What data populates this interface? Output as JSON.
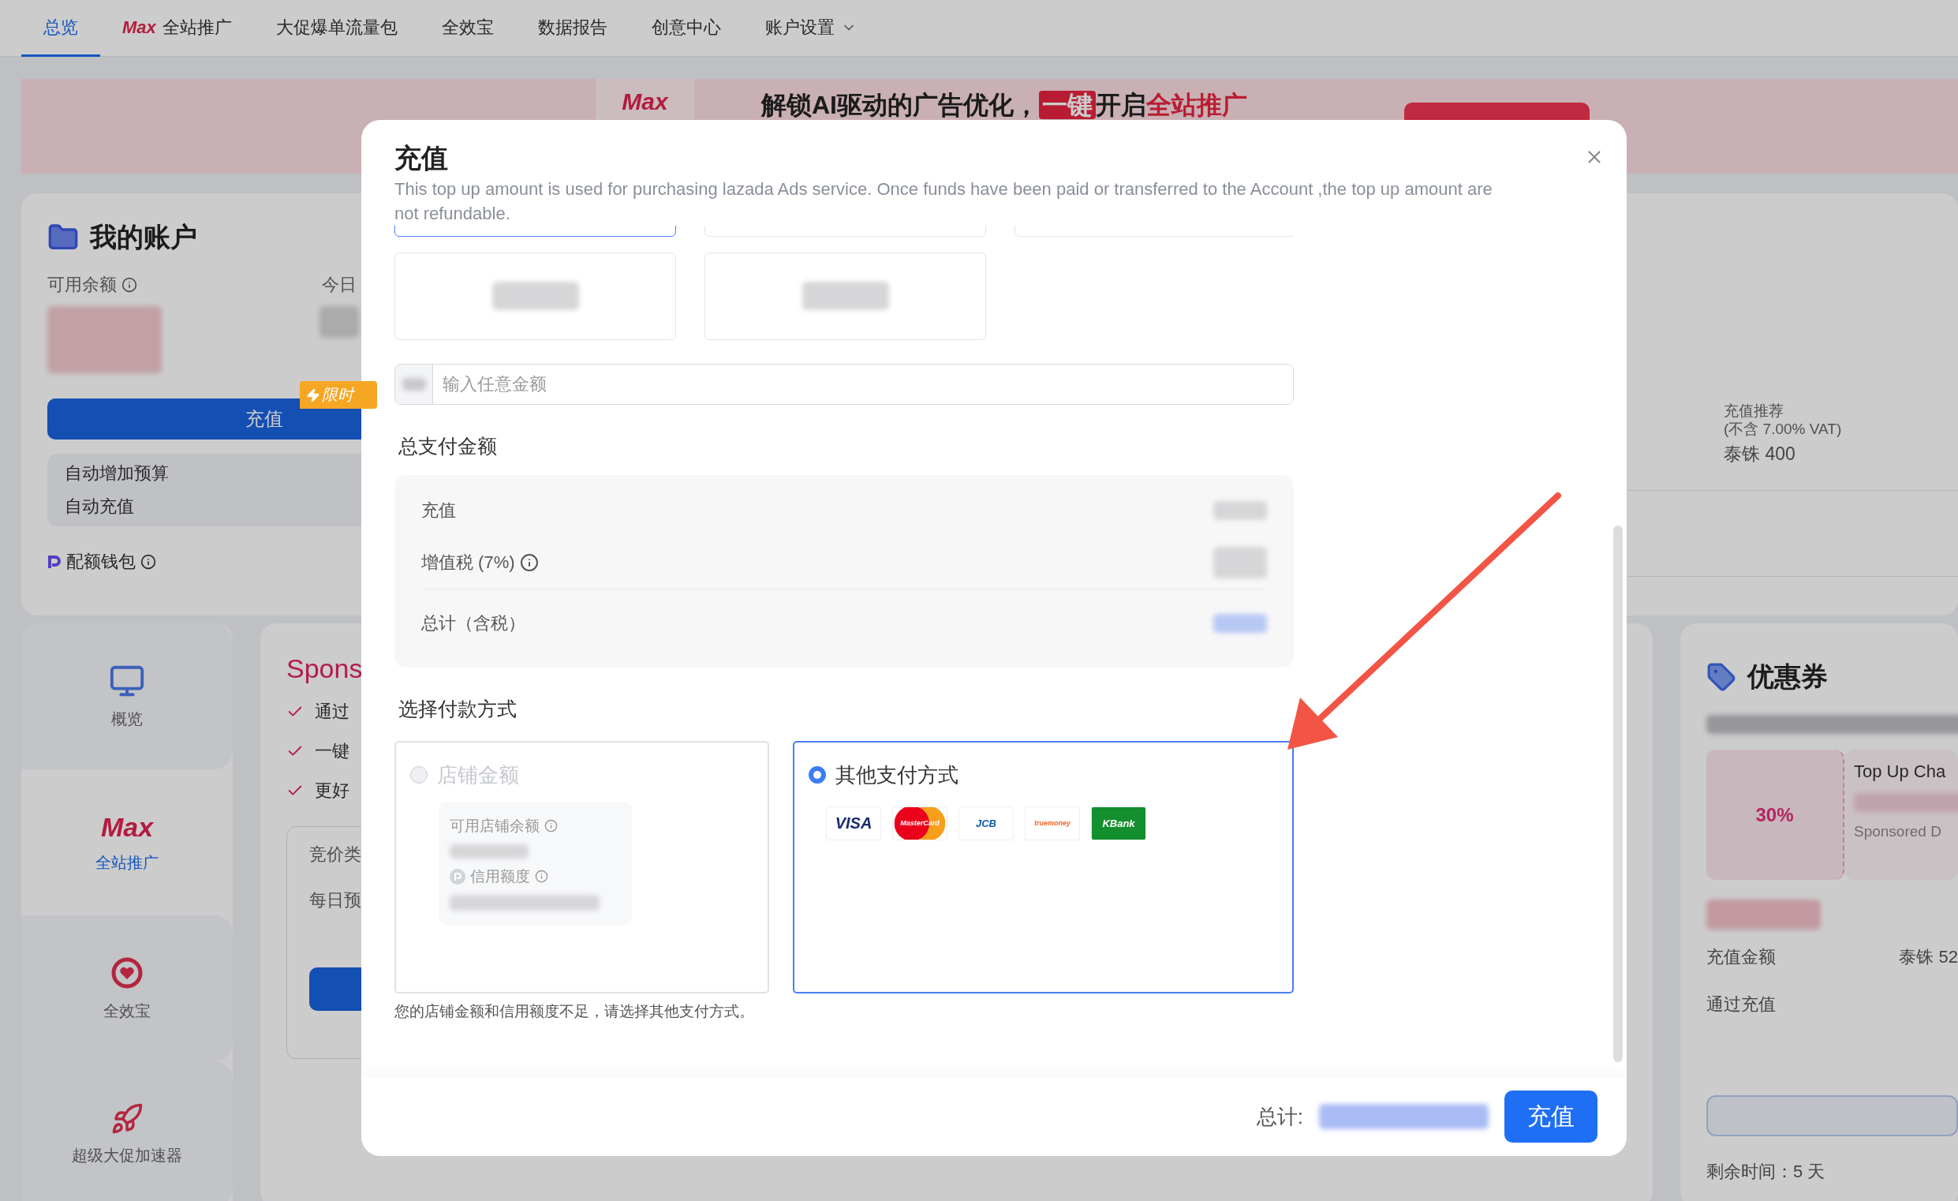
{
  "nav": {
    "tabs": [
      {
        "label": "总览",
        "selected": true
      },
      {
        "label": "全站推广",
        "selected": false,
        "logo": "Max"
      },
      {
        "label": "大促爆单流量包",
        "selected": false
      },
      {
        "label": "全效宝",
        "selected": false
      },
      {
        "label": "数据报告",
        "selected": false
      },
      {
        "label": "创意中心",
        "selected": false
      },
      {
        "label": "账户设置",
        "selected": false,
        "dropdown": true
      }
    ]
  },
  "banner": {
    "logo": "Max",
    "headline": [
      {
        "text": "解锁AI驱动的广告优化，",
        "kind": "plain"
      },
      {
        "text": "一键",
        "kind": "boxed"
      },
      {
        "text": "开启",
        "kind": "plain"
      },
      {
        "text": "全站推广",
        "kind": "accent"
      }
    ]
  },
  "account": {
    "title": "我的账户",
    "balance_label": "可用余额",
    "today_label": "今日",
    "promo_badge": "限时",
    "topup_button": "充值",
    "auto_options": [
      "自动增加预算",
      "自动充值"
    ],
    "wallet_label": "配额钱包"
  },
  "side_nav": [
    {
      "label": "概览",
      "kind": "screen",
      "selected": false
    },
    {
      "label": "全站推广",
      "kind": "logo",
      "logo": "Max",
      "selected": true
    },
    {
      "label": "全效宝",
      "kind": "heart",
      "selected": false
    },
    {
      "label": "超级大促加速器",
      "kind": "rocket",
      "selected": false
    }
  ],
  "sponsored": {
    "title": "Spons",
    "features": [
      "通过",
      "一键",
      "更好"
    ],
    "fields": [
      "竞价类",
      "每日预"
    ]
  },
  "recommendation": {
    "label": "充值推荐",
    "note": "(不含 7.00% VAT)",
    "amount": "泰铢 400"
  },
  "coupons": {
    "title": "优惠券",
    "discount": "30%",
    "coupon_title": "Top Up Cha",
    "coupon_tag": "Sponsored D",
    "amount_label": "充值金额",
    "amount_value": "泰铢 52",
    "method": "通过充值",
    "remaining": "剩余时间：5 天"
  },
  "modal": {
    "title": "充值",
    "notice": "This top up amount is used for purchasing lazada Ads service. Once funds have been paid or transferred to the Account ,the top up amount are not refundable.",
    "amount_options": [
      {
        "selected": true
      },
      {
        "selected": false
      },
      {
        "selected": false
      },
      {
        "selected": false
      },
      {
        "selected": false
      }
    ],
    "custom_amount": {
      "placeholder": "输入任意金额"
    },
    "summary_title": "总支付金额",
    "summary_rows": [
      {
        "label": "充值",
        "kind": "plain"
      },
      {
        "label": "增值税 (7%)",
        "kind": "info"
      },
      {
        "label": "总计（含税）",
        "kind": "total"
      }
    ],
    "payment_title": "选择付款方式",
    "payment_methods": [
      {
        "kind": "store",
        "label": "店铺金额",
        "selected": false,
        "disabled": true,
        "balance_label": "可用店铺余额",
        "credit_label": "信用额度"
      },
      {
        "kind": "other",
        "label": "其他支付方式",
        "selected": true,
        "disabled": false,
        "logos": [
          {
            "label": "VISA",
            "kind": "visa"
          },
          {
            "label": "MasterCard",
            "kind": "mastercard"
          },
          {
            "label": "JCB",
            "kind": "jcb"
          },
          {
            "label": "truemoney",
            "kind": "truemoney"
          },
          {
            "label": "KBank",
            "kind": "kbank"
          }
        ]
      }
    ],
    "payment_note": "您的店铺金额和信用额度不足，请选择其他支付方式。",
    "total_label": "总计:",
    "confirm_button": "充值"
  }
}
